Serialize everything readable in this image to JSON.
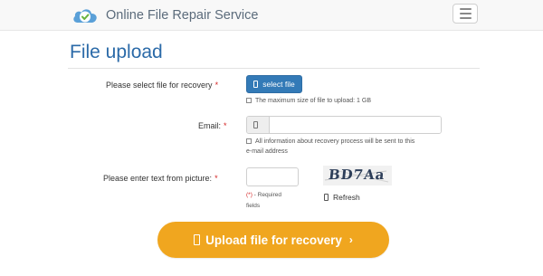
{
  "header": {
    "brand": "Online File Repair Service",
    "menu_button": "menu"
  },
  "page": {
    "title": "File upload"
  },
  "form": {
    "file_label": "Please select file for recovery",
    "required_marker": "*",
    "select_button": "select file",
    "file_hint": "The maximum size of file to upload: 1 GB",
    "email_label": "Email:",
    "email_value": "",
    "email_hint_line1": "All information about recovery process will be sent to this",
    "email_hint_line2": "e-mail address",
    "captcha_label": "Please enter text from picture:",
    "captcha_value": "",
    "captcha_text": "BD7Aa",
    "refresh": "Refresh",
    "required_note_star": "(*)",
    "required_note_text": " - Required",
    "required_note_line2": "fields",
    "upload_button": "Upload file for recovery",
    "upload_chevron": "›"
  },
  "colors": {
    "brand_title": "#2b6aa8",
    "primary_button": "#337ab7",
    "upload_button": "#f0a61f",
    "required": "#d42424"
  },
  "icons": [
    "cloud-check-icon",
    "hamburger-icon",
    "file-icon",
    "checkbox-icon"
  ]
}
